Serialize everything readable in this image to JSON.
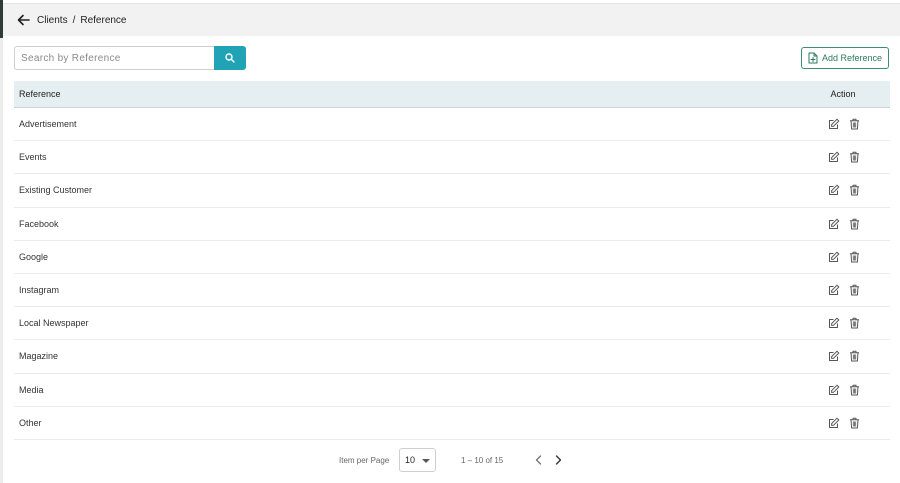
{
  "header": {
    "breadcrumb_parent": "Clients",
    "breadcrumb_separator": "/",
    "breadcrumb_current": "Reference"
  },
  "search": {
    "placeholder": "Search by Reference",
    "value": ""
  },
  "toolbar": {
    "add_label": "Add Reference"
  },
  "table": {
    "columns": [
      "Reference",
      "Action"
    ],
    "rows": [
      "Advertisement",
      "Events",
      "Existing Customer",
      "Facebook",
      "Google",
      "Instagram",
      "Local Newspaper",
      "Magazine",
      "Media",
      "Other"
    ]
  },
  "pagination": {
    "items_per_page_label": "Item per Page",
    "items_per_page": "10",
    "range_text": "1 – 10 of 15"
  },
  "colors": {
    "search_button": "#1fa3b5",
    "add_button_border": "#3a8f72",
    "table_header_bg": "#e5eef0"
  },
  "icons": {
    "back": "arrow-left-icon",
    "search": "search-icon",
    "add": "file-plus-icon",
    "edit": "edit-icon",
    "delete": "trash-icon",
    "prev": "chevron-left-icon",
    "next": "chevron-right-icon"
  }
}
